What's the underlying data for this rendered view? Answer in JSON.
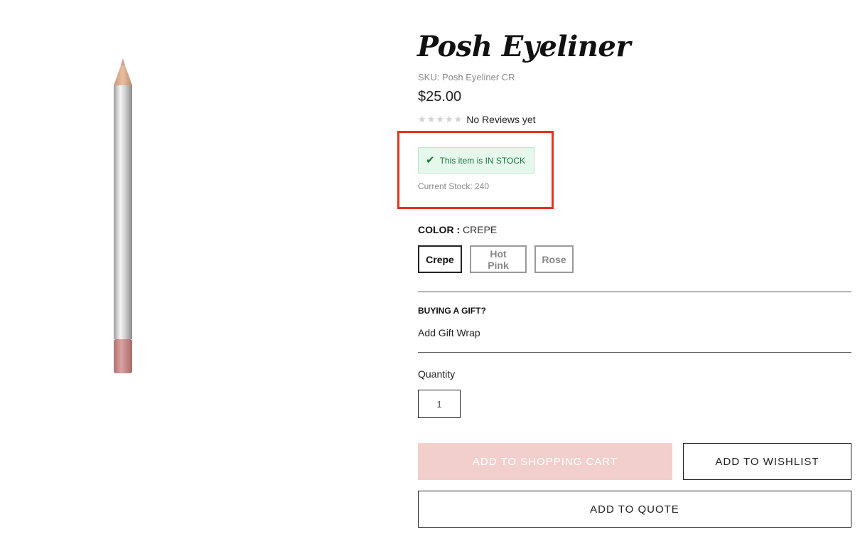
{
  "product": {
    "title": "Posh Eyeliner",
    "sku": "SKU: Posh Eyeliner CR",
    "price": "$25.00",
    "rating": 0,
    "reviews_text": "No Reviews yet",
    "image_icon": "eyeliner-pencil-image"
  },
  "stock": {
    "badge_text": "This item is IN STOCK",
    "current_stock_text": "Current Stock: 240",
    "badge_color": "#1d7a3a",
    "highlight_color": "#e8321e"
  },
  "color_option": {
    "label": "COLOR :",
    "selected_value": "CREPE",
    "swatches": [
      "Crepe",
      "Hot Pink",
      "Rose"
    ]
  },
  "gift": {
    "heading": "BUYING A GIFT?",
    "option_text": "Add Gift Wrap"
  },
  "quantity": {
    "label": "Quantity",
    "value": "1"
  },
  "actions": {
    "add_to_cart": "ADD TO SHOPPING CART",
    "add_to_wishlist": "ADD TO WISHLIST",
    "add_to_quote": "ADD TO QUOTE",
    "cart_color": "#f2cfcc"
  }
}
